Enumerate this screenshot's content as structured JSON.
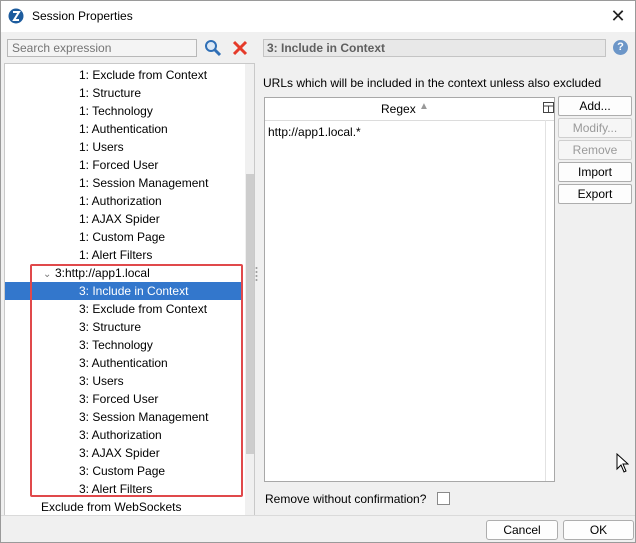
{
  "window": {
    "title": "Session Properties"
  },
  "search": {
    "placeholder": "Search expression"
  },
  "tree": {
    "items": [
      {
        "label": "1: Exclude from Context",
        "level": 2
      },
      {
        "label": "1: Structure",
        "level": 2
      },
      {
        "label": "1: Technology",
        "level": 2
      },
      {
        "label": "1: Authentication",
        "level": 2
      },
      {
        "label": "1: Users",
        "level": 2
      },
      {
        "label": "1: Forced User",
        "level": 2
      },
      {
        "label": "1: Session Management",
        "level": 2
      },
      {
        "label": "1: Authorization",
        "level": 2
      },
      {
        "label": "1: AJAX Spider",
        "level": 2
      },
      {
        "label": "1: Custom Page",
        "level": 2
      },
      {
        "label": "1: Alert Filters",
        "level": 2
      },
      {
        "label": "3:http://app1.local",
        "level": 1,
        "expanded": true
      },
      {
        "label": "3: Include in Context",
        "level": 2,
        "selected": true
      },
      {
        "label": "3: Exclude from Context",
        "level": 2
      },
      {
        "label": "3: Structure",
        "level": 2
      },
      {
        "label": "3: Technology",
        "level": 2
      },
      {
        "label": "3: Authentication",
        "level": 2
      },
      {
        "label": "3: Users",
        "level": 2
      },
      {
        "label": "3: Forced User",
        "level": 2
      },
      {
        "label": "3: Session Management",
        "level": 2
      },
      {
        "label": "3: Authorization",
        "level": 2
      },
      {
        "label": "3: AJAX Spider",
        "level": 2
      },
      {
        "label": "3: Custom Page",
        "level": 2
      },
      {
        "label": "3: Alert Filters",
        "level": 2
      },
      {
        "label": "Exclude from WebSockets",
        "level": 0
      }
    ]
  },
  "panel": {
    "title": "3: Include in Context",
    "description": "URLs which will be included in the context unless also excluded",
    "column_header": "Regex",
    "rows": [
      "http://app1.local.*"
    ],
    "remove_without_confirmation": "Remove without confirmation?",
    "remove_checked": false
  },
  "buttons": {
    "add": "Add...",
    "modify": "Modify...",
    "remove": "Remove",
    "import": "Import",
    "export": "Export"
  },
  "footer": {
    "cancel": "Cancel",
    "ok": "OK"
  },
  "colors": {
    "selection": "#3377cc",
    "highlight": "#e0494b"
  }
}
